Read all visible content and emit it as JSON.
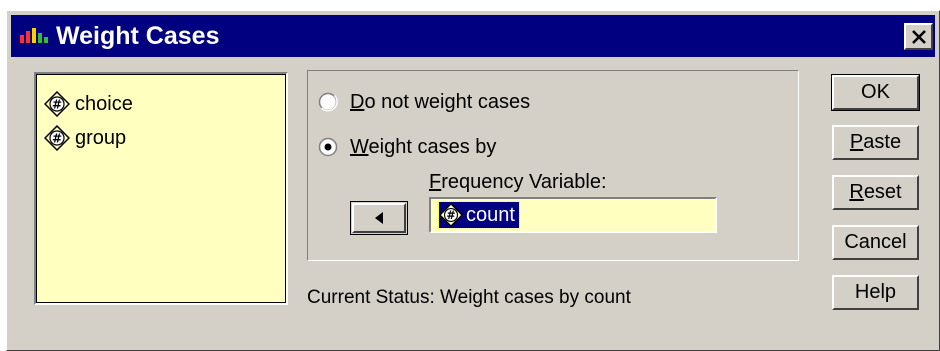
{
  "window": {
    "title": "Weight Cases",
    "close_glyph": "✕"
  },
  "variables": [
    {
      "name": "choice",
      "icon": "numeric-variable-icon"
    },
    {
      "name": "group",
      "icon": "numeric-variable-icon"
    }
  ],
  "weighting": {
    "options": [
      {
        "mnemonic": "D",
        "rest": "o not weight cases",
        "selected": false
      },
      {
        "mnemonic": "W",
        "rest": "eight cases by",
        "selected": true
      }
    ],
    "frequency_label_mnemonic": "F",
    "frequency_label_rest": "requency Variable:",
    "frequency_variable": "count",
    "move_button_icon": "left-triangle-icon"
  },
  "status": {
    "text": "Current Status:  Weight cases by count"
  },
  "buttons": {
    "ok": "OK",
    "paste_mnemonic": "P",
    "paste_rest": "aste",
    "reset_mnemonic": "R",
    "reset_rest": "eset",
    "cancel": "Cancel",
    "help": "Help"
  }
}
